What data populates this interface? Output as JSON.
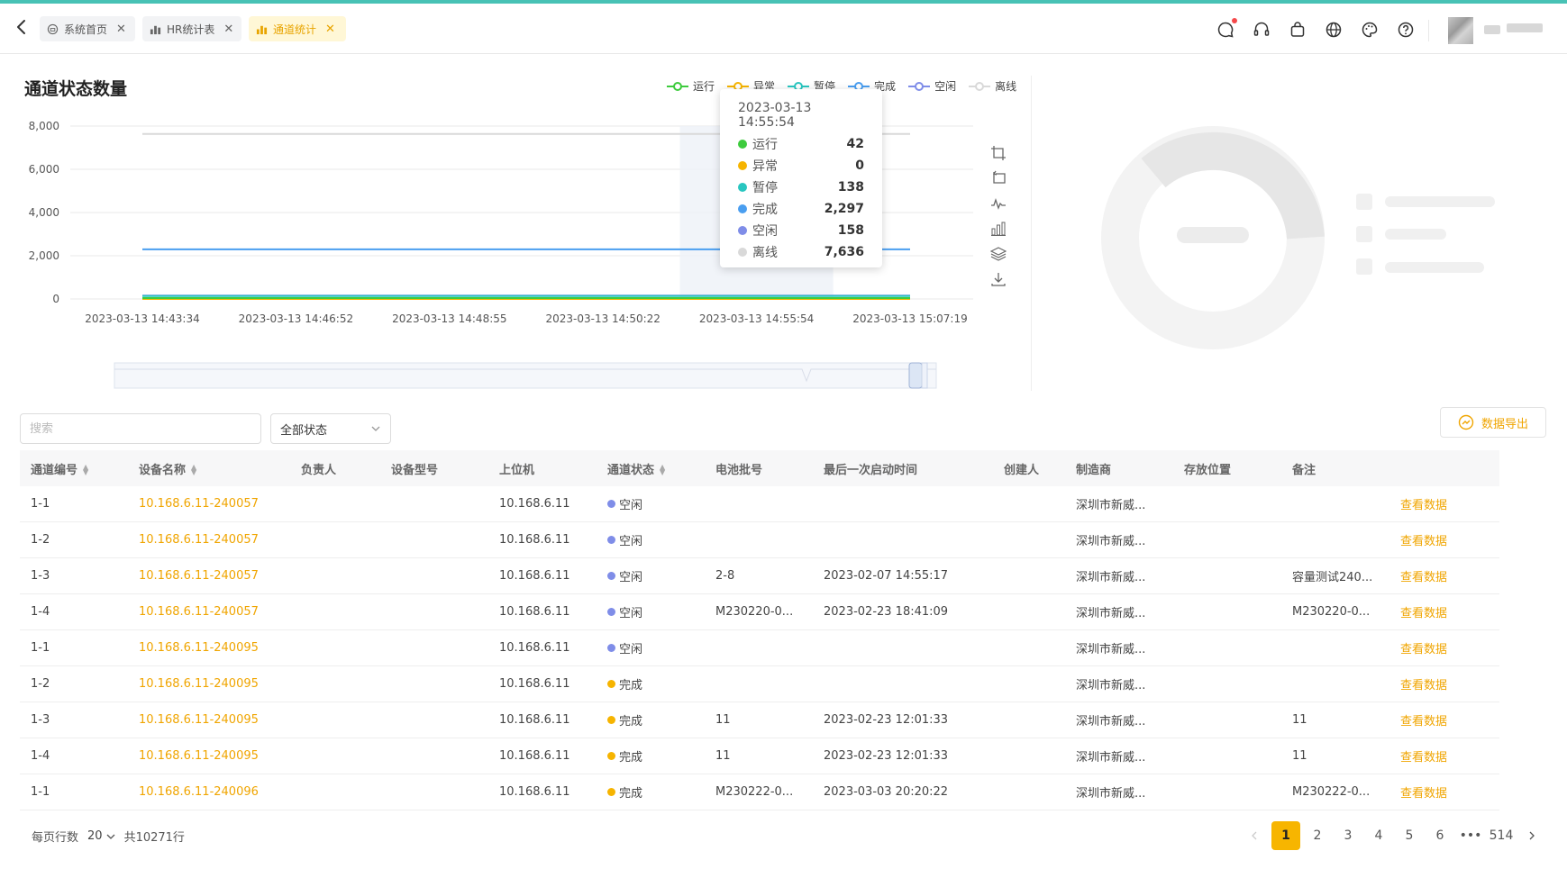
{
  "tabs": [
    {
      "label": "系统首页",
      "icon": "home-icon",
      "active": false
    },
    {
      "label": "HR统计表",
      "icon": "bar-chart-icon",
      "active": false
    },
    {
      "label": "通道统计",
      "icon": "bar-chart-icon",
      "active": true
    }
  ],
  "chart_panel": {
    "title": "通道状态数量",
    "tools": [
      "zoom-area-icon",
      "zoom-reset-icon",
      "line-type-icon",
      "bar-type-icon",
      "stack-icon",
      "download-icon"
    ]
  },
  "chart_data": {
    "type": "line",
    "x": [
      "2023-03-13 14:43:34",
      "2023-03-13 14:46:52",
      "2023-03-13 14:48:55",
      "2023-03-13 14:50:22",
      "2023-03-13 14:55:54",
      "2023-03-13 15:07:19"
    ],
    "ylim": [
      0,
      8000
    ],
    "yticks": [
      "8,000",
      "6,000",
      "4,000",
      "2,000",
      "0"
    ],
    "grid": true,
    "legend_position": "top-right",
    "series": [
      {
        "name": "运行",
        "color": "#3dcb3d",
        "values": [
          42,
          42,
          42,
          42,
          42,
          42
        ]
      },
      {
        "name": "异常",
        "color": "#f6b400",
        "values": [
          0,
          0,
          0,
          0,
          0,
          0
        ]
      },
      {
        "name": "暂停",
        "color": "#29c6c0",
        "values": [
          138,
          138,
          138,
          138,
          138,
          138
        ]
      },
      {
        "name": "完成",
        "color": "#4a9ef0",
        "values": [
          2297,
          2297,
          2297,
          2297,
          2297,
          2297
        ]
      },
      {
        "name": "空闲",
        "color": "#7f8de8",
        "values": [
          158,
          158,
          158,
          158,
          158,
          158
        ]
      },
      {
        "name": "离线",
        "color": "#d9d9d9",
        "values": [
          7636,
          7636,
          7636,
          7636,
          7636,
          7636
        ]
      }
    ],
    "tooltip": {
      "time": "2023-03-13 14:55:54",
      "rows": [
        {
          "name": "运行",
          "value": "42",
          "color": "#3dcb3d"
        },
        {
          "name": "异常",
          "value": "0",
          "color": "#f6b400"
        },
        {
          "name": "暂停",
          "value": "138",
          "color": "#29c6c0"
        },
        {
          "name": "完成",
          "value": "2,297",
          "color": "#4a9ef0"
        },
        {
          "name": "空闲",
          "value": "158",
          "color": "#7f8de8"
        },
        {
          "name": "离线",
          "value": "7,636",
          "color": "#d9d9d9"
        }
      ]
    }
  },
  "filters": {
    "search_placeholder": "搜索",
    "status_select": "全部状态",
    "export_label": "数据导出"
  },
  "table": {
    "columns": [
      "通道编号",
      "设备名称",
      "负责人",
      "设备型号",
      "上位机",
      "通道状态",
      "电池批号",
      "最后一次启动时间",
      "创建人",
      "制造商",
      "存放位置",
      "备注",
      ""
    ],
    "rows": [
      {
        "ch": "1-1",
        "device": "10.168.6.11-240057",
        "host": "10.168.6.11",
        "status": "空闲",
        "status_color": "#7f8de8",
        "batch": "",
        "last": "",
        "maker": "深圳市新威...",
        "note": "",
        "action": "查看数据"
      },
      {
        "ch": "1-2",
        "device": "10.168.6.11-240057",
        "host": "10.168.6.11",
        "status": "空闲",
        "status_color": "#7f8de8",
        "batch": "",
        "last": "",
        "maker": "深圳市新威...",
        "note": "",
        "action": "查看数据"
      },
      {
        "ch": "1-3",
        "device": "10.168.6.11-240057",
        "host": "10.168.6.11",
        "status": "空闲",
        "status_color": "#7f8de8",
        "batch": "2-8",
        "last": "2023-02-07 14:55:17",
        "maker": "深圳市新威...",
        "note": "容量测试240...",
        "action": "查看数据"
      },
      {
        "ch": "1-4",
        "device": "10.168.6.11-240057",
        "host": "10.168.6.11",
        "status": "空闲",
        "status_color": "#7f8de8",
        "batch": "M230220-0...",
        "last": "2023-02-23 18:41:09",
        "maker": "深圳市新威...",
        "note": "M230220-0...",
        "action": "查看数据"
      },
      {
        "ch": "1-1",
        "device": "10.168.6.11-240095",
        "host": "10.168.6.11",
        "status": "空闲",
        "status_color": "#7f8de8",
        "batch": "",
        "last": "",
        "maker": "深圳市新威...",
        "note": "",
        "action": "查看数据"
      },
      {
        "ch": "1-2",
        "device": "10.168.6.11-240095",
        "host": "10.168.6.11",
        "status": "完成",
        "status_color": "#f6b400",
        "batch": "",
        "last": "",
        "maker": "深圳市新威...",
        "note": "",
        "action": "查看数据"
      },
      {
        "ch": "1-3",
        "device": "10.168.6.11-240095",
        "host": "10.168.6.11",
        "status": "完成",
        "status_color": "#f6b400",
        "batch": "11",
        "last": "2023-02-23 12:01:33",
        "maker": "深圳市新威...",
        "note": "11",
        "action": "查看数据"
      },
      {
        "ch": "1-4",
        "device": "10.168.6.11-240095",
        "host": "10.168.6.11",
        "status": "完成",
        "status_color": "#f6b400",
        "batch": "11",
        "last": "2023-02-23 12:01:33",
        "maker": "深圳市新威...",
        "note": "11",
        "action": "查看数据"
      },
      {
        "ch": "1-1",
        "device": "10.168.6.11-240096",
        "host": "10.168.6.11",
        "status": "完成",
        "status_color": "#f6b400",
        "batch": "M230222-0...",
        "last": "2023-03-03 20:20:22",
        "maker": "深圳市新威...",
        "note": "M230222-0...",
        "action": "查看数据"
      }
    ]
  },
  "footer": {
    "rows_per_page_label": "每页行数",
    "rows_per_page": "20",
    "total": "共10271行",
    "pages": [
      "1",
      "2",
      "3",
      "4",
      "5",
      "6",
      "•••",
      "514"
    ],
    "current_page": "1"
  },
  "accent_color": "#f0a500"
}
